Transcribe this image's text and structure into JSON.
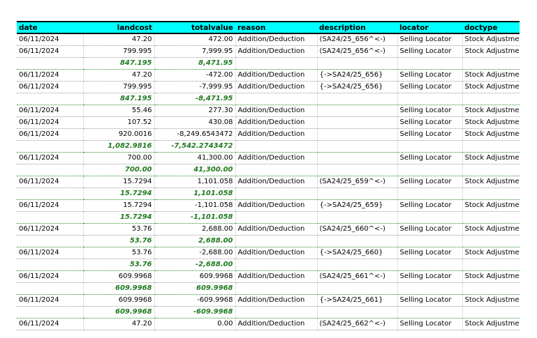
{
  "columns": [
    "date",
    "landcost",
    "totalvalue",
    "reason",
    "description",
    "locator",
    "doctype"
  ],
  "rows": [
    {
      "type": "detail",
      "cells": [
        "06/11/2024",
        "47.20",
        "472.00",
        "Addition/Deduction",
        "(SA24/25_656^<-)",
        "Selling Locator",
        "Stock Adjustment"
      ]
    },
    {
      "type": "detail",
      "cells": [
        "06/11/2024",
        "799.995",
        "7,999.95",
        "Addition/Deduction",
        "(SA24/25_656^<-)",
        "Selling Locator",
        "Stock Adjustment"
      ]
    },
    {
      "type": "subtotal",
      "cells": [
        "",
        "847.195",
        "8,471.95",
        "",
        "",
        "",
        ""
      ]
    },
    {
      "type": "detail",
      "cells": [
        "06/11/2024",
        "47.20",
        "-472.00",
        "Addition/Deduction",
        "{->SA24/25_656}",
        "Selling Locator",
        "Stock Adjustment"
      ]
    },
    {
      "type": "detail",
      "cells": [
        "06/11/2024",
        "799.995",
        "-7,999.95",
        "Addition/Deduction",
        "{->SA24/25_656}",
        "Selling Locator",
        "Stock Adjustment"
      ]
    },
    {
      "type": "subtotal",
      "cells": [
        "",
        "847.195",
        "-8,471.95",
        "",
        "",
        "",
        ""
      ]
    },
    {
      "type": "detail",
      "cells": [
        "06/11/2024",
        "55.46",
        "277.30",
        "Addition/Deduction",
        "",
        "Selling Locator",
        "Stock Adjustment"
      ]
    },
    {
      "type": "detail",
      "cells": [
        "06/11/2024",
        "107.52",
        "430.08",
        "Addition/Deduction",
        "",
        "Selling Locator",
        "Stock Adjustment"
      ]
    },
    {
      "type": "detail",
      "cells": [
        "06/11/2024",
        "920.0016",
        "-8,249.6543472",
        "Addition/Deduction",
        "",
        "Selling Locator",
        "Stock Adjustment"
      ]
    },
    {
      "type": "subtotal",
      "cells": [
        "",
        "1,082.9816",
        "-7,542.2743472",
        "",
        "",
        "",
        ""
      ]
    },
    {
      "type": "detail",
      "cells": [
        "06/11/2024",
        "700.00",
        "41,300.00",
        "Addition/Deduction",
        "",
        "Selling Locator",
        "Stock Adjustment"
      ]
    },
    {
      "type": "subtotal",
      "cells": [
        "",
        "700.00",
        "41,300.00",
        "",
        "",
        "",
        ""
      ]
    },
    {
      "type": "detail",
      "cells": [
        "06/11/2024",
        "15.7294",
        "1,101.058",
        "Addition/Deduction",
        "(SA24/25_659^<-)",
        "Selling Locator",
        "Stock Adjustment"
      ]
    },
    {
      "type": "subtotal",
      "cells": [
        "",
        "15.7294",
        "1,101.058",
        "",
        "",
        "",
        ""
      ]
    },
    {
      "type": "detail",
      "cells": [
        "06/11/2024",
        "15.7294",
        "-1,101.058",
        "Addition/Deduction",
        "{->SA24/25_659}",
        "Selling Locator",
        "Stock Adjustment"
      ]
    },
    {
      "type": "subtotal",
      "cells": [
        "",
        "15.7294",
        "-1,101.058",
        "",
        "",
        "",
        ""
      ]
    },
    {
      "type": "detail",
      "cells": [
        "06/11/2024",
        "53.76",
        "2,688.00",
        "Addition/Deduction",
        "(SA24/25_660^<-)",
        "Selling Locator",
        "Stock Adjustment"
      ]
    },
    {
      "type": "subtotal",
      "cells": [
        "",
        "53.76",
        "2,688.00",
        "",
        "",
        "",
        ""
      ]
    },
    {
      "type": "detail",
      "cells": [
        "06/11/2024",
        "53.76",
        "-2,688.00",
        "Addition/Deduction",
        "{->SA24/25_660}",
        "Selling Locator",
        "Stock Adjustment"
      ]
    },
    {
      "type": "subtotal",
      "cells": [
        "",
        "53.76",
        "-2,688.00",
        "",
        "",
        "",
        ""
      ]
    },
    {
      "type": "detail",
      "cells": [
        "06/11/2024",
        "609.9968",
        "609.9968",
        "Addition/Deduction",
        "(SA24/25_661^<-)",
        "Selling Locator",
        "Stock Adjustment"
      ]
    },
    {
      "type": "subtotal",
      "cells": [
        "",
        "609.9968",
        "609.9968",
        "",
        "",
        "",
        ""
      ]
    },
    {
      "type": "detail",
      "cells": [
        "06/11/2024",
        "609.9968",
        "-609.9968",
        "Addition/Deduction",
        "{->SA24/25_661}",
        "Selling Locator",
        "Stock Adjustment"
      ]
    },
    {
      "type": "subtotal",
      "cells": [
        "",
        "609.9968",
        "-609.9968",
        "",
        "",
        "",
        ""
      ]
    },
    {
      "type": "detail",
      "cells": [
        "06/11/2024",
        "47.20",
        "0.00",
        "Addition/Deduction",
        "(SA24/25_662^<-)",
        "Selling Locator",
        "Stock Adjustment"
      ]
    }
  ]
}
